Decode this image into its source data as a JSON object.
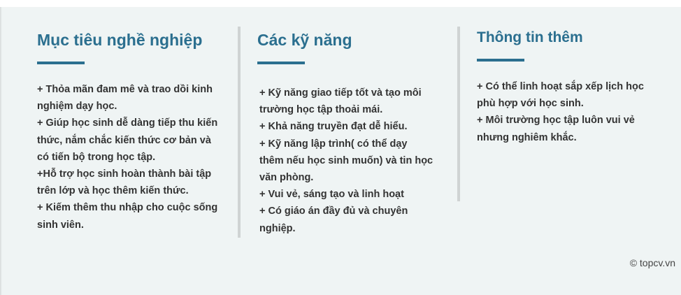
{
  "columns": [
    {
      "title": "Mục tiêu nghề nghiệp",
      "lines": [
        "+ Thỏa mãn đam mê và trao dồi kinh",
        "nghiệm dạy học.",
        "+ Giúp học sinh dễ dàng tiếp thu kiến",
        "thức, nắm chắc kiến thức cơ bản và",
        "có tiến bộ trong học tập.",
        "+Hỗ trợ học sinh hoàn thành bài tập",
        "trên lớp và học thêm kiến thức.",
        "+ Kiếm thêm thu nhập cho cuộc sống",
        "sinh viên."
      ]
    },
    {
      "title": "Các kỹ năng",
      "lines": [
        "+ Kỹ năng giao tiếp tốt và tạo môi",
        "trường học tập thoải mái.",
        "+ Khả năng truyền đạt dễ hiểu.",
        "+ Kỹ năng lập trình( có thể dạy",
        "thêm nếu học sinh muốn) và tin học",
        "văn phòng.",
        "+ Vui vẻ, sáng tạo và linh hoạt",
        "+ Có giáo án đầy đủ và chuyên",
        "nghiệp."
      ]
    },
    {
      "title": "Thông tin thêm",
      "lines": [
        "+ Có thể linh hoạt sắp xếp lịch học",
        "phù hợp với học sinh.",
        "+ Môi trường học tập luôn vui vẻ",
        "nhưng nghiêm khắc."
      ]
    }
  ],
  "watermark": "© topcv.vn",
  "colors": {
    "accent": "#2b6f8f",
    "background": "#eff4f4",
    "text": "#333333",
    "separator": "#cfd3d3"
  }
}
